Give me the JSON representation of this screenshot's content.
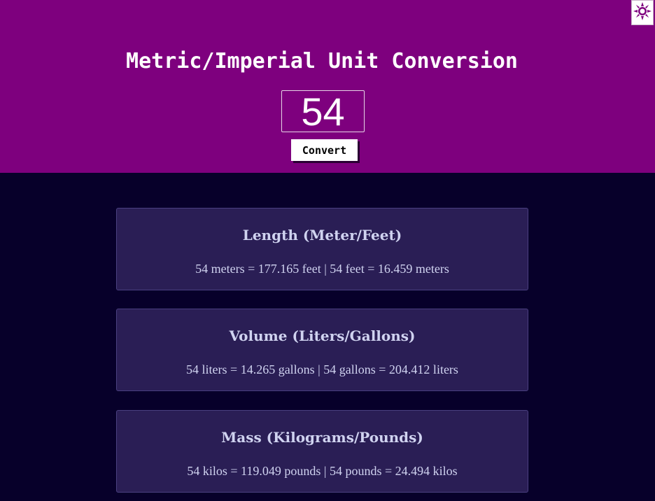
{
  "header": {
    "title": "Metric/Imperial Unit Conversion",
    "input_value": "54",
    "convert_label": "Convert",
    "theme_icon": "sun-icon",
    "background_color": "#7e007e"
  },
  "conversions": [
    {
      "heading": "Length (Meter/Feet)",
      "result": "54 meters = 177.165 feet | 54 feet = 16.459 meters"
    },
    {
      "heading": "Volume (Liters/Gallons)",
      "result": "54 liters = 14.265 gallons | 54 gallons = 204.412 liters"
    },
    {
      "heading": "Mass (Kilograms/Pounds)",
      "result": "54 kilos = 119.049 pounds | 54 pounds = 24.494 kilos"
    }
  ],
  "colors": {
    "page_background": "#07002a",
    "card_background": "#2a1e55",
    "card_text": "#d0d3f0"
  }
}
